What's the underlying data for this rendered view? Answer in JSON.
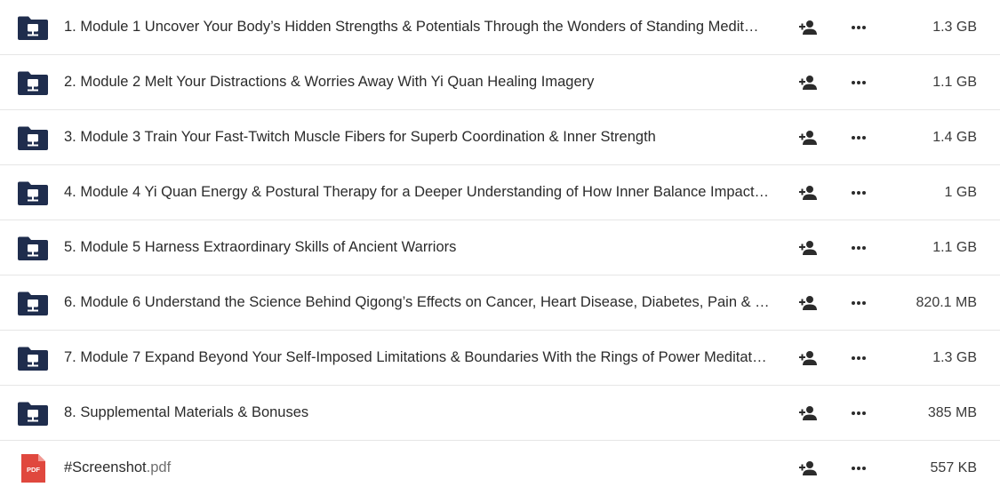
{
  "colors": {
    "folder": "#1f2d4d",
    "pdf": "#e0483e",
    "text": "#2b2b2b",
    "muted": "#6f6f6f",
    "divider": "#e6e6e6"
  },
  "files": [
    {
      "type": "folder",
      "icon": "network-folder-icon",
      "name": "1. Module 1 Uncover Your Body’s Hidden Strengths & Potentials Through the Wonders of Standing Medit…",
      "size": "1.3 GB"
    },
    {
      "type": "folder",
      "icon": "network-folder-icon",
      "name": "2. Module 2 Melt Your Distractions & Worries Away With Yi Quan Healing Imagery",
      "size": "1.1 GB"
    },
    {
      "type": "folder",
      "icon": "network-folder-icon",
      "name": "3. Module 3 Train Your Fast-Twitch Muscle Fibers for Superb Coordination & Inner Strength",
      "size": "1.4 GB"
    },
    {
      "type": "folder",
      "icon": "network-folder-icon",
      "name": "4. Module 4 Yi Quan Energy & Postural Therapy for a Deeper Understanding of How Inner Balance Impact…",
      "size": "1 GB"
    },
    {
      "type": "folder",
      "icon": "network-folder-icon",
      "name": "5. Module 5 Harness Extraordinary Skills of Ancient Warriors",
      "size": "1.1 GB"
    },
    {
      "type": "folder",
      "icon": "network-folder-icon",
      "name": "6. Module 6 Understand the Science Behind Qigong’s Effects on Cancer, Heart Disease, Diabetes, Pain & …",
      "size": "820.1 MB"
    },
    {
      "type": "folder",
      "icon": "network-folder-icon",
      "name": "7. Module 7 Expand Beyond Your Self-Imposed Limitations & Boundaries With the Rings of Power Meditat…",
      "size": "1.3 GB"
    },
    {
      "type": "folder",
      "icon": "network-folder-icon",
      "name": "8. Supplemental Materials & Bonuses",
      "size": "385 MB"
    },
    {
      "type": "pdf",
      "icon": "pdf-file-icon",
      "icon_label": "PDF",
      "name": "#Screenshot",
      "ext": ".pdf",
      "size": "557 KB"
    }
  ],
  "actions": {
    "share_icon": "add-person-icon",
    "more_icon": "more-options-icon"
  }
}
